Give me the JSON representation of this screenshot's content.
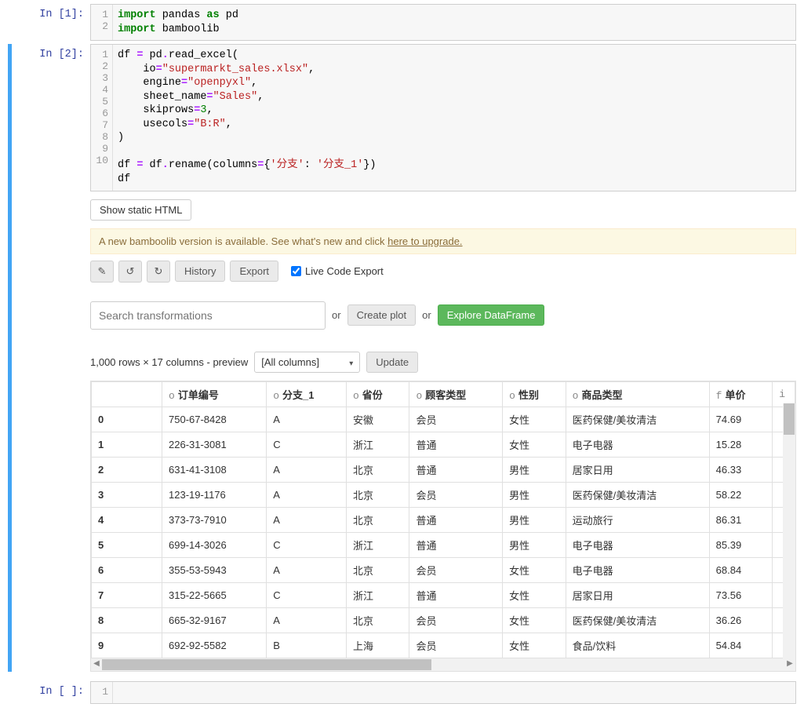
{
  "cells": {
    "cell1": {
      "prompt": "In [1]:",
      "gutter": [
        "1",
        "2"
      ],
      "code": {
        "l1_kw1": "import",
        "l1_t1": " pandas ",
        "l1_kw2": "as",
        "l1_t2": " pd",
        "l2_kw1": "import",
        "l2_t1": " bamboolib"
      }
    },
    "cell2": {
      "prompt": "In [2]:",
      "gutter": [
        "1",
        "2",
        "3",
        "4",
        "5",
        "6",
        "7",
        "8",
        "9",
        "10"
      ],
      "code": {
        "l1": "df ",
        "l1op": "=",
        "l1b": " pd",
        "l1c": ".",
        "l1d": "read_excel(",
        "l2a": "    io",
        "l2op": "=",
        "l2s": "\"supermarkt_sales.xlsx\"",
        "l2e": ",",
        "l3a": "    engine",
        "l3op": "=",
        "l3s": "\"openpyxl\"",
        "l3e": ",",
        "l4a": "    sheet_name",
        "l4op": "=",
        "l4s": "\"Sales\"",
        "l4e": ",",
        "l5a": "    skiprows",
        "l5op": "=",
        "l5n": "3",
        "l5e": ",",
        "l6a": "    usecols",
        "l6op": "=",
        "l6s": "\"B:R\"",
        "l6e": ",",
        "l7": ")",
        "l8": "",
        "l9a": "df ",
        "l9op": "=",
        "l9b": " df",
        "l9c": ".",
        "l9d": "rename(columns",
        "l9op2": "=",
        "l9e": "{",
        "l9s1": "'分支'",
        "l9f": ": ",
        "l9s2": "'分支_1'",
        "l9g": "})",
        "l10": "df"
      }
    },
    "cell3": {
      "prompt": "In [ ]:",
      "gutter": [
        "1"
      ]
    }
  },
  "output": {
    "show_static_btn": "Show static HTML",
    "notice_prefix": "A new bamboolib version is available. See what's new and click ",
    "notice_link": "here to upgrade.",
    "history_btn": "History",
    "export_btn": "Export",
    "live_code_label": "Live Code Export",
    "search_placeholder": "Search transformations",
    "or_text": "or",
    "create_plot_btn": "Create plot",
    "explore_btn": "Explore DataFrame",
    "preview_text": "1,000 rows × 17 columns - preview",
    "columns_select": "[All columns]",
    "update_btn": "Update"
  },
  "table": {
    "columns": [
      {
        "type": "",
        "name": ""
      },
      {
        "type": "o",
        "name": "订单编号"
      },
      {
        "type": "o",
        "name": "分支_1"
      },
      {
        "type": "o",
        "name": "省份"
      },
      {
        "type": "o",
        "name": "顾客类型"
      },
      {
        "type": "o",
        "name": "性别"
      },
      {
        "type": "o",
        "name": "商品类型"
      },
      {
        "type": "f",
        "name": "单价"
      },
      {
        "type": "i",
        "name": ""
      }
    ],
    "rows": [
      {
        "idx": "0",
        "c1": "750-67-8428",
        "c2": "A",
        "c3": "安徽",
        "c4": "会员",
        "c5": "女性",
        "c6": "医药保健/美妆清洁",
        "c7": "74.69"
      },
      {
        "idx": "1",
        "c1": "226-31-3081",
        "c2": "C",
        "c3": "浙江",
        "c4": "普通",
        "c5": "女性",
        "c6": "电子电器",
        "c7": "15.28"
      },
      {
        "idx": "2",
        "c1": "631-41-3108",
        "c2": "A",
        "c3": "北京",
        "c4": "普通",
        "c5": "男性",
        "c6": "居家日用",
        "c7": "46.33"
      },
      {
        "idx": "3",
        "c1": "123-19-1176",
        "c2": "A",
        "c3": "北京",
        "c4": "会员",
        "c5": "男性",
        "c6": "医药保健/美妆清洁",
        "c7": "58.22"
      },
      {
        "idx": "4",
        "c1": "373-73-7910",
        "c2": "A",
        "c3": "北京",
        "c4": "普通",
        "c5": "男性",
        "c6": "运动旅行",
        "c7": "86.31"
      },
      {
        "idx": "5",
        "c1": "699-14-3026",
        "c2": "C",
        "c3": "浙江",
        "c4": "普通",
        "c5": "男性",
        "c6": "电子电器",
        "c7": "85.39"
      },
      {
        "idx": "6",
        "c1": "355-53-5943",
        "c2": "A",
        "c3": "北京",
        "c4": "会员",
        "c5": "女性",
        "c6": "电子电器",
        "c7": "68.84"
      },
      {
        "idx": "7",
        "c1": "315-22-5665",
        "c2": "C",
        "c3": "浙江",
        "c4": "普通",
        "c5": "女性",
        "c6": "居家日用",
        "c7": "73.56"
      },
      {
        "idx": "8",
        "c1": "665-32-9167",
        "c2": "A",
        "c3": "北京",
        "c4": "会员",
        "c5": "女性",
        "c6": "医药保健/美妆清洁",
        "c7": "36.26"
      },
      {
        "idx": "9",
        "c1": "692-92-5582",
        "c2": "B",
        "c3": "上海",
        "c4": "会员",
        "c5": "女性",
        "c6": "食品/饮料",
        "c7": "54.84"
      }
    ]
  }
}
